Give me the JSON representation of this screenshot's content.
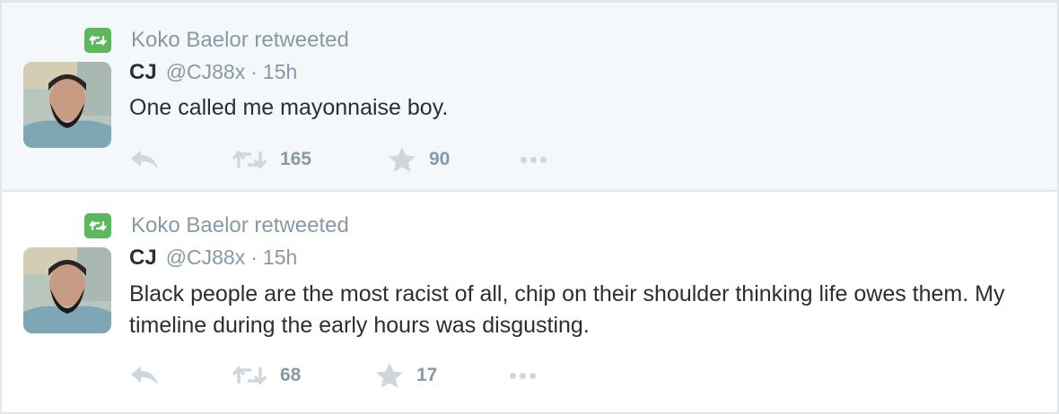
{
  "tweets": [
    {
      "retweeted_by": "Koko Baelor retweeted",
      "name": "CJ",
      "handle": "@CJ88x",
      "separator": "·",
      "time": "15h",
      "text": "One called me mayonnaise boy.",
      "retweets": "165",
      "favorites": "90"
    },
    {
      "retweeted_by": "Koko Baelor retweeted",
      "name": "CJ",
      "handle": "@CJ88x",
      "separator": "·",
      "time": "15h",
      "text": "Black people are the most racist of all, chip on their shoulder thinking life owes them. My timeline during the early hours was disgusting.",
      "retweets": "68",
      "favorites": "17"
    }
  ],
  "colors": {
    "retweet_badge": "#5cb85c",
    "muted_text": "#8899a6",
    "icon": "#cfd7de",
    "highlighted_bg": "#f5f8fa"
  },
  "icons": {
    "reply": "reply-icon",
    "retweet": "retweet-icon",
    "favorite": "star-icon",
    "more": "more-dots-icon"
  }
}
